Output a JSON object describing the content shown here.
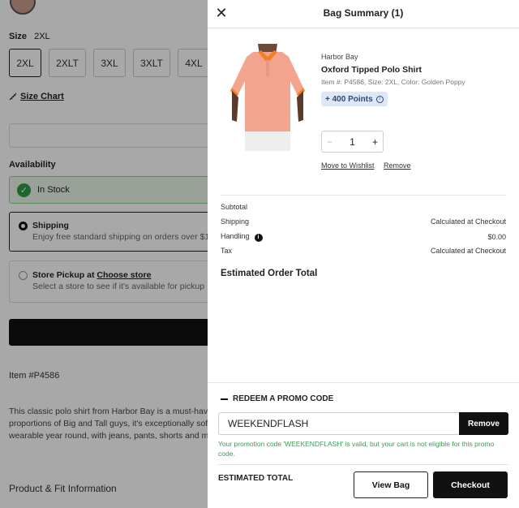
{
  "background": {
    "size_label": "Size",
    "size_value": "2XL",
    "sizes": [
      "2XL",
      "2XLT",
      "3XL",
      "3XLT",
      "4XL"
    ],
    "size_chart": "Size Chart",
    "availability": "Availability",
    "in_stock": "In Stock",
    "shipping_title": "Shipping",
    "shipping_sub": "Enjoy free standard shipping on orders over $10",
    "pickup_prefix": "Store Pickup at ",
    "pickup_link": "Choose store",
    "pickup_sub": "Select a store to see if it's available for pickup",
    "item_number": "Item #P4586",
    "description_lines": [
      "This classic polo shirt from Harbor Bay is a must-have",
      "proportions of Big and Tall guys, it's exceptionally soft,",
      "wearable year round, with jeans, pants, shorts and mor"
    ],
    "product_fit": "Product & Fit Information"
  },
  "drawer": {
    "title": "Bag Summary (1)",
    "item": {
      "brand": "Harbor Bay",
      "name": "Oxford Tipped Polo Shirt",
      "meta": "Item #: P4586, Size: 2XL, Color: Golden Poppy",
      "points": "+ 400 Points",
      "quantity": "1",
      "minus": "−",
      "plus": "+",
      "move_to_wishlist": "Move to Wishlist",
      "remove": "Remove"
    },
    "summary": {
      "subtotal_label": "Subtotal",
      "subtotal_value": "",
      "shipping_label": "Shipping",
      "shipping_value": "Calculated at Checkout",
      "handling_label": "Handling",
      "handling_value": "$0.00",
      "tax_label": "Tax",
      "tax_value": "Calculated at Checkout",
      "estimated_order_total": "Estimated Order Total"
    },
    "promo": {
      "heading": "REDEEM A PROMO CODE",
      "code": "WEEKENDFLASH",
      "remove_button": "Remove",
      "message": "Your promotion code 'WEEKENDFLASH' is valid, but your cart is not eligible for this promo code."
    },
    "estimated_total": "ESTIMATED TOTAL",
    "view_bag": "View Bag",
    "checkout": "Checkout"
  },
  "colors": {
    "accent": "#111111",
    "promo_success": "#3a9a55",
    "points_bg": "#dde7f5",
    "shirt": "#f3a48e",
    "collar": "#f07f27"
  }
}
